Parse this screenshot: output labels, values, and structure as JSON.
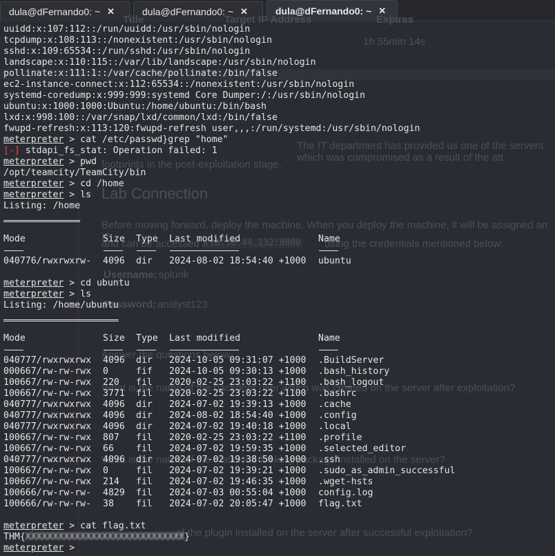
{
  "tabs": [
    {
      "label": "dula@dFernando0: ~",
      "active": false
    },
    {
      "label": "dula@dFernando0: ~",
      "active": false
    },
    {
      "label": "dula@dFernando0: ~",
      "active": true
    }
  ],
  "close_glyph": "✕",
  "background_page": {
    "col_title": "Title",
    "col_ip": "Target IP Address",
    "col_expires": "Expires",
    "expires_value": "1h 55min 14s",
    "intro_1": "The IT department has provided us one of the servers which was compromised as a result of the att",
    "intro_2": "footprints in the post-exploitation stage.",
    "heading": "Lab Connection",
    "para_1": "Before moving forward, deploy the machine. When you deploy the machine, it will be assigned an IP",
    "para_2": "and can be accessed at",
    "ip_port": "10.10.44.132:8000",
    "para_3": "using the credentials mentioned below:",
    "username_label": "Username:",
    "username": "splunk",
    "password_label": "Password:",
    "password": "analyst123",
    "answer_heading": "Answer the questions below",
    "q1": "What is the name of the backdoor user which was created on the server after exploitation?",
    "q2": "What is the name of the malicious-looking package installed on the server?",
    "q3": "of the plugin installed on the server after successful exploitation?"
  },
  "terminal": {
    "prompt": "meterpreter",
    "lines": [
      {
        "t": "text",
        "v": "uuidd:x:107:112::/run/uuidd:/usr/sbin/nologin"
      },
      {
        "t": "text",
        "v": "tcpdump:x:108:113::/nonexistent:/usr/sbin/nologin"
      },
      {
        "t": "text",
        "v": "sshd:x:109:65534::/run/sshd:/usr/sbin/nologin"
      },
      {
        "t": "text",
        "v": "landscape:x:110:115::/var/lib/landscape:/usr/sbin/nologin"
      },
      {
        "t": "text",
        "v": "pollinate:x:111:1::/var/cache/pollinate:/bin/false"
      },
      {
        "t": "text",
        "v": "ec2-instance-connect:x:112:65534::/nonexistent:/usr/sbin/nologin"
      },
      {
        "t": "text",
        "v": "systemd-coredump:x:999:999:systemd Core Dumper:/:/usr/sbin/nologin"
      },
      {
        "t": "text",
        "v": "ubuntu:x:1000:1000:Ubuntu:/home/ubuntu:/bin/bash"
      },
      {
        "t": "text",
        "v": "lxd:x:998:100::/var/snap/lxd/common/lxd:/bin/false"
      },
      {
        "t": "text",
        "v": "fwupd-refresh:x:113:120:fwupd-refresh user,,,:/run/systemd:/usr/sbin/nologin"
      },
      {
        "t": "cmd",
        "v": "cat /etc/passwd}grep \"home\""
      },
      {
        "t": "err",
        "tag": "[-]",
        "v": " stdapi_fs_stat: Operation failed: 1"
      },
      {
        "t": "cmd",
        "v": "pwd"
      },
      {
        "t": "text",
        "v": "/opt/teamcity/TeamCity/bin"
      },
      {
        "t": "cmd",
        "v": "cd /home"
      },
      {
        "t": "cmd",
        "v": "ls"
      },
      {
        "t": "text",
        "v": "Listing: /home"
      },
      {
        "t": "text",
        "v": "=============="
      },
      {
        "t": "text",
        "v": ""
      },
      {
        "t": "row",
        "v": [
          "Mode",
          "Size",
          "Type",
          "Last modified",
          "Name"
        ]
      },
      {
        "t": "row",
        "v": [
          "----",
          "----",
          "----",
          "-------------",
          "----"
        ]
      },
      {
        "t": "row",
        "v": [
          "040776/rwxrwxrw-",
          "4096",
          "dir",
          "2024-08-02 18:54:40 +1000",
          "ubuntu"
        ]
      },
      {
        "t": "text",
        "v": ""
      },
      {
        "t": "cmd",
        "v": "cd ubuntu"
      },
      {
        "t": "cmd",
        "v": "ls"
      },
      {
        "t": "text",
        "v": "Listing: /home/ubuntu"
      },
      {
        "t": "text",
        "v": "====================="
      },
      {
        "t": "text",
        "v": ""
      },
      {
        "t": "row",
        "v": [
          "Mode",
          "Size",
          "Type",
          "Last modified",
          "Name"
        ]
      },
      {
        "t": "row",
        "v": [
          "----",
          "----",
          "----",
          "-------------",
          "----"
        ]
      },
      {
        "t": "row",
        "v": [
          "040777/rwxrwxrwx",
          "4096",
          "dir",
          "2024-10-05 09:31:07 +1000",
          ".BuildServer"
        ]
      },
      {
        "t": "row",
        "v": [
          "000667/rw-rw-rwx",
          "0",
          "fif",
          "2024-10-05 09:30:13 +1000",
          ".bash_history"
        ]
      },
      {
        "t": "row",
        "v": [
          "100667/rw-rw-rwx",
          "220",
          "fil",
          "2020-02-25 23:03:22 +1100",
          ".bash_logout"
        ]
      },
      {
        "t": "row",
        "v": [
          "100667/rw-rw-rwx",
          "3771",
          "fil",
          "2020-02-25 23:03:22 +1100",
          ".bashrc"
        ]
      },
      {
        "t": "row",
        "v": [
          "040777/rwxrwxrwx",
          "4096",
          "dir",
          "2024-07-02 19:39:13 +1000",
          ".cache"
        ]
      },
      {
        "t": "row",
        "v": [
          "040777/rwxrwxrwx",
          "4096",
          "dir",
          "2024-08-02 18:54:40 +1000",
          ".config"
        ]
      },
      {
        "t": "row",
        "v": [
          "040777/rwxrwxrwx",
          "4096",
          "dir",
          "2024-07-02 19:40:18 +1000",
          ".local"
        ]
      },
      {
        "t": "row",
        "v": [
          "100667/rw-rw-rwx",
          "807",
          "fil",
          "2020-02-25 23:03:22 +1100",
          ".profile"
        ]
      },
      {
        "t": "row",
        "v": [
          "100667/rw-rw-rwx",
          "66",
          "fil",
          "2024-07-02 19:59:35 +1000",
          ".selected_editor"
        ]
      },
      {
        "t": "row",
        "v": [
          "040777/rwxrwxrwx",
          "4096",
          "dir",
          "2024-07-02 19:38:50 +1000",
          ".ssh"
        ]
      },
      {
        "t": "row",
        "v": [
          "100667/rw-rw-rwx",
          "0",
          "fil",
          "2024-07-02 19:39:21 +1000",
          ".sudo_as_admin_successful"
        ]
      },
      {
        "t": "row",
        "v": [
          "100667/rw-rw-rwx",
          "214",
          "fil",
          "2024-07-02 19:46:35 +1000",
          ".wget-hsts"
        ]
      },
      {
        "t": "row",
        "v": [
          "100666/rw-rw-rw-",
          "4829",
          "fil",
          "2024-07-03 00:55:04 +1000",
          "config.log"
        ]
      },
      {
        "t": "row",
        "v": [
          "100666/rw-rw-rw-",
          "38",
          "fil",
          "2024-07-02 20:05:47 +1000",
          "flag.txt"
        ]
      },
      {
        "t": "text",
        "v": ""
      },
      {
        "t": "cmd",
        "v": "cat flag.txt"
      },
      {
        "t": "flag",
        "pre": "THM{",
        "hidden": "XXXXXXXXXXXXXXXXXXXXXXXXXXXXX",
        "post": "}"
      },
      {
        "t": "cmd",
        "v": ""
      }
    ]
  }
}
